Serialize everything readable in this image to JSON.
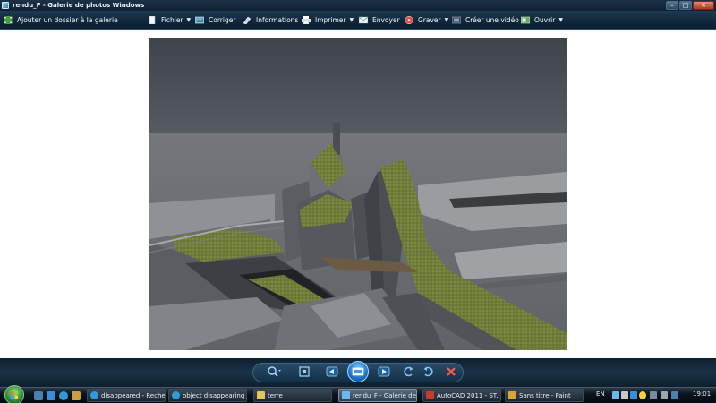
{
  "window": {
    "title": "rendu_F - Galerie de photos Windows",
    "controls": [
      "minimize",
      "maximize",
      "close"
    ]
  },
  "menu": {
    "add_to_gallery": "Ajouter un dossier à la galerie",
    "file": "Fichier",
    "fix": "Corriger",
    "info": "Informations",
    "print": "Imprimer",
    "email": "Envoyer",
    "burn": "Graver",
    "make_movie": "Créer une vidéo",
    "open": "Ouvrir"
  },
  "image": {
    "description_icon": "architectural-3d-render"
  },
  "playback": {
    "buttons": [
      "zoom-icon",
      "actual-size-icon",
      "previous-icon",
      "slideshow-icon",
      "next-icon",
      "rotate-left-icon",
      "rotate-right-icon",
      "delete-icon"
    ]
  },
  "taskbar": {
    "tasks": [
      {
        "label": "disappeared - Reche...",
        "icon": "ie-icon"
      },
      {
        "label": "object disappearing ...",
        "icon": "ie-icon"
      },
      {
        "label": "terre",
        "icon": "folder-icon"
      },
      {
        "label": "rendu_F - Galerie de...",
        "icon": "photo-gallery-icon"
      },
      {
        "label": "AutoCAD 2011 - ST...",
        "icon": "autocad-icon"
      },
      {
        "label": "Sans titre - Paint",
        "icon": "paint-icon"
      }
    ],
    "language": "EN",
    "clock": "19:01"
  },
  "colors": {
    "chrome_dark": "#0f2233",
    "content_bg": "#ffffff",
    "accent_blue": "#1a72c8",
    "close_red": "#b5351c"
  }
}
